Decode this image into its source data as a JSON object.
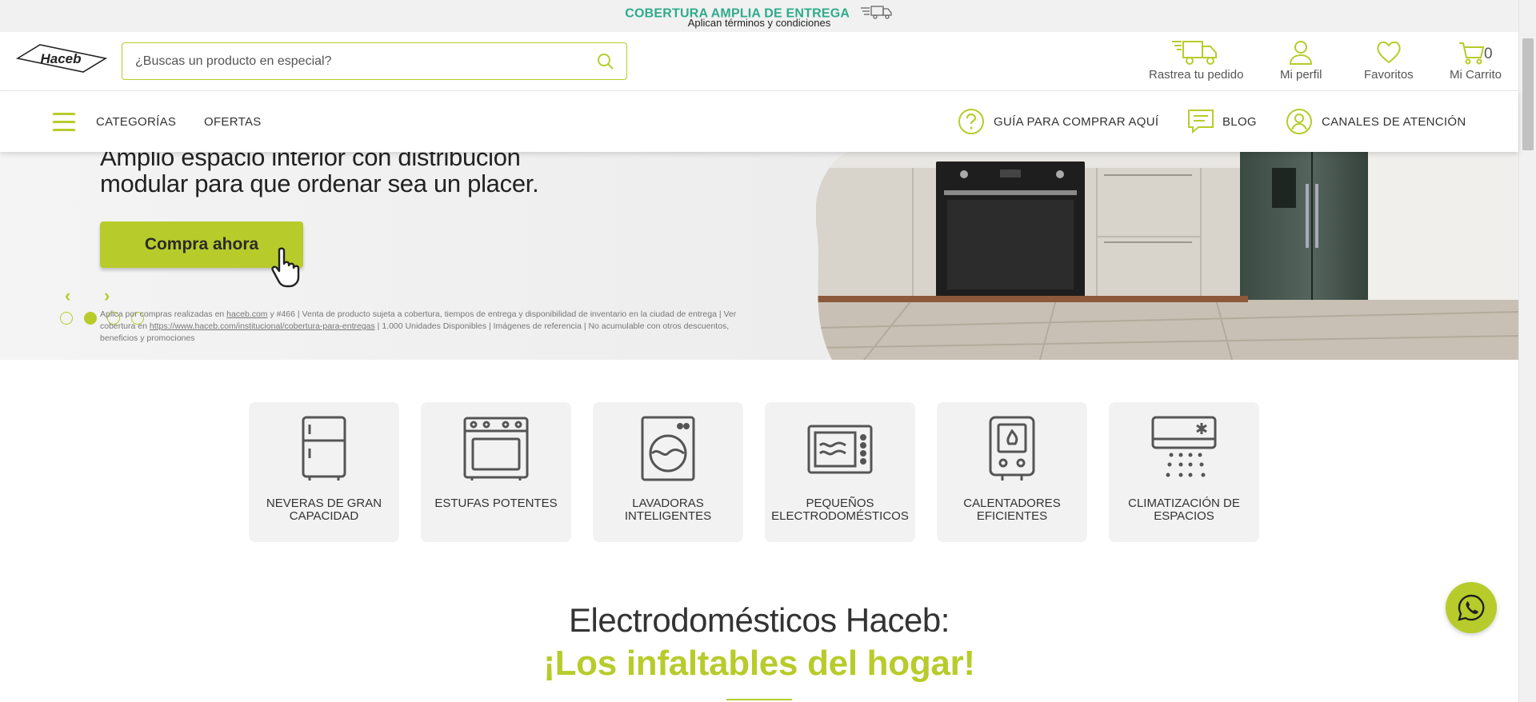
{
  "topbar": {
    "title": "COBERTURA AMPLIA DE ENTREGA",
    "subtitle": "Aplican términos y condiciones"
  },
  "header": {
    "logo_text": "Haceb",
    "search_placeholder": "¿Buscas un producto en especial?",
    "track_label": "Rastrea tu pedido",
    "profile_label": "Mi perfil",
    "favorites_label": "Favoritos",
    "cart_label": "Mi Carrito",
    "cart_count": "0"
  },
  "nav": {
    "categories": "CATEGORÍAS",
    "offers": "OFERTAS",
    "guide": "GUÍA PARA COMPRAR AQUÍ",
    "blog": "BLOG",
    "channels": "CANALES DE ATENCIÓN"
  },
  "hero": {
    "line1": "Amplio espacio interior con distribución",
    "line2": "modular para que ordenar sea un placer.",
    "cta": "Compra ahora",
    "fine_prefix": "Aplica por compras realizadas en ",
    "fine_link1": "haceb.com",
    "fine_mid": " y #466 | Venta de producto sujeta a cobertura, tiempos de entrega y disponibilidad de inventario en la ciudad de entrega | Ver cobertura en ",
    "fine_link2": "https://www.haceb.com/institucional/cobertura-para-entregas",
    "fine_suffix": " | 1.000 Unidades Disponibles | Imágenes de referencia | No acumulable con otros descuentos, beneficios y promociones",
    "active_slide": 2,
    "slide_count": 4
  },
  "categories": [
    {
      "label": "NEVERAS DE GRAN CAPACIDAD",
      "icon": "fridge-icon"
    },
    {
      "label": "ESTUFAS POTENTES",
      "icon": "stove-icon"
    },
    {
      "label": "LAVADORAS INTELIGENTES",
      "icon": "washer-icon"
    },
    {
      "label": "PEQUEÑOS ELECTRODOMÉSTICOS",
      "icon": "microwave-icon"
    },
    {
      "label": "CALENTADORES EFICIENTES",
      "icon": "heater-icon"
    },
    {
      "label": "CLIMATIZACIÓN DE ESPACIOS",
      "icon": "air-conditioner-icon"
    }
  ],
  "section": {
    "title": "Electrodomésticos Haceb:",
    "subtitle": "¡Los infaltables del hogar!"
  },
  "colors": {
    "accent": "#b7cc2b",
    "topbar_green": "#2dab8c"
  }
}
